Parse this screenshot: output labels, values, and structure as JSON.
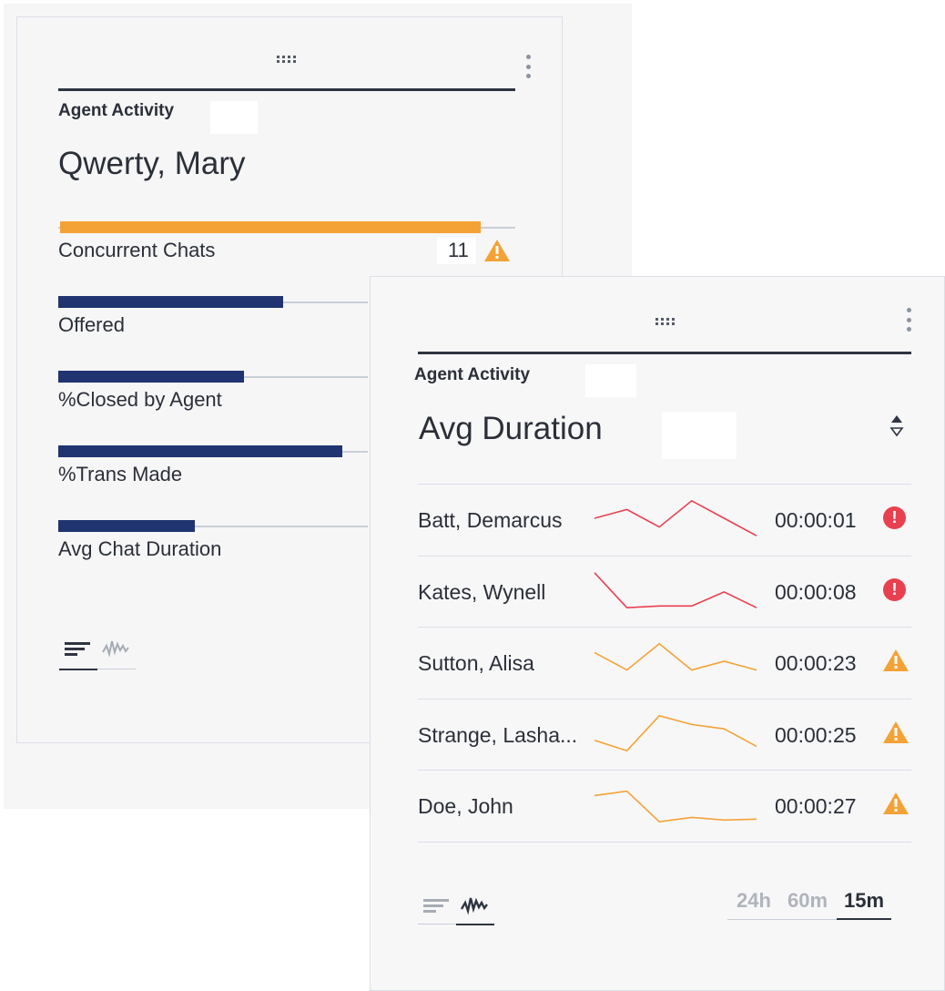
{
  "colors": {
    "warning": "#f4a236",
    "error": "#e8404e",
    "bar": "#1f3470",
    "track": "#c9ced6"
  },
  "card1": {
    "drag_icon": "drag-handle-icon",
    "menu_icon": "more-vertical-icon",
    "widget_type": "Agent Activity",
    "title": "Qwerty, Mary",
    "metrics": [
      {
        "label": "Concurrent Chats",
        "value": "11",
        "status": "warning",
        "fill": 0.92,
        "color": "#f4a236"
      },
      {
        "label": "Offered",
        "fill": 0.46,
        "color": "#1f3470"
      },
      {
        "label": "%Closed by Agent",
        "fill": 0.38,
        "color": "#1f3470"
      },
      {
        "label": "%Trans Made",
        "fill": 0.58,
        "color": "#1f3470"
      },
      {
        "label": "Avg Chat Duration",
        "fill": 0.28,
        "color": "#1f3470"
      }
    ],
    "view_tabs": [
      {
        "icon": "list-view-icon",
        "selected": true
      },
      {
        "icon": "sparkline-view-icon",
        "selected": false
      }
    ]
  },
  "card2": {
    "drag_icon": "drag-handle-icon",
    "menu_icon": "more-vertical-icon",
    "widget_type": "Agent Activity",
    "title": "Avg Duration",
    "sort_icon": "sort-icon",
    "rows": [
      {
        "name": "Batt, Demarcus",
        "value": "00:00:01",
        "status": "error",
        "trend": [
          3,
          4,
          2,
          5,
          3,
          1
        ]
      },
      {
        "name": "Kates, Wynell",
        "value": "00:00:08",
        "status": "error",
        "trend": [
          5,
          1,
          1.2,
          1.2,
          2.8,
          1
        ]
      },
      {
        "name": "Sutton, Alisa",
        "value": "00:00:23",
        "status": "warning",
        "trend": [
          4,
          2,
          5,
          2,
          3,
          2
        ]
      },
      {
        "name": "Strange, Lasha...",
        "value": "00:00:25",
        "status": "warning",
        "trend": [
          2.2,
          1,
          5,
          4,
          3.5,
          1.5
        ]
      },
      {
        "name": "Doe, John",
        "value": "00:00:27",
        "status": "warning",
        "trend": [
          4,
          4.5,
          1,
          1.5,
          1.2,
          1.3
        ]
      }
    ],
    "view_tabs": [
      {
        "icon": "list-view-icon",
        "selected": false
      },
      {
        "icon": "sparkline-view-icon",
        "selected": true
      }
    ],
    "time_ranges": [
      {
        "label": "24h",
        "selected": false
      },
      {
        "label": "60m",
        "selected": false
      },
      {
        "label": "15m",
        "selected": true
      }
    ]
  }
}
